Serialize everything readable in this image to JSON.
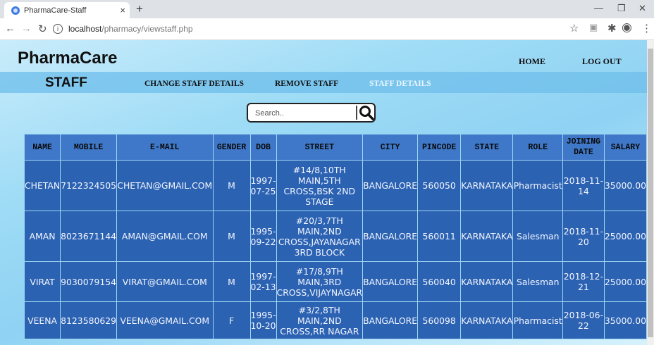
{
  "browser": {
    "tab_title": "PharmaCare-Staff",
    "tab_close": "×",
    "new_tab": "+",
    "url_host": "localhost",
    "url_path": "/pharmacy/viewstaff.php"
  },
  "header": {
    "logo": "PharmaCare",
    "home": "HOME",
    "logout": "LOG OUT"
  },
  "subnav": {
    "title": "STAFF",
    "change": "CHANGE STAFF DETAILS",
    "remove": "REMOVE STAFF",
    "details": "STAFF DETAILS"
  },
  "search": {
    "placeholder": "Search.."
  },
  "table": {
    "headers": [
      "NAME",
      "MOBILE",
      "E-MAIL",
      "GENDER",
      "DOB",
      "STREET",
      "CITY",
      "PINCODE",
      "STATE",
      "ROLE",
      "JOINING DATE",
      "SALARY"
    ],
    "rows": [
      {
        "name": "CHETAN",
        "mobile": "7122324505",
        "email": "CHETAN@GMAIL.COM",
        "gender": "M",
        "dob": "1997-07-25",
        "street": "#14/8,10TH MAIN,5TH CROSS,BSK 2ND STAGE",
        "city": "BANGALORE",
        "pincode": "560050",
        "state": "KARNATAKA",
        "role": "Pharmacist",
        "joining": "2018-11-14",
        "salary": "35000.00"
      },
      {
        "name": "AMAN",
        "mobile": "8023671144",
        "email": "AMAN@GMAIL.COM",
        "gender": "M",
        "dob": "1995-09-22",
        "street": "#20/3,7TH MAIN,2ND CROSS,JAYANAGAR 3RD BLOCK",
        "city": "BANGALORE",
        "pincode": "560011",
        "state": "KARNATAKA",
        "role": "Salesman",
        "joining": "2018-11-20",
        "salary": "25000.00"
      },
      {
        "name": "VIRAT",
        "mobile": "9030079154",
        "email": "VIRAT@GMAIL.COM",
        "gender": "M",
        "dob": "1997-02-13",
        "street": "#17/8,9TH MAIN,3RD CROSS,VIJAYNAGAR",
        "city": "BANGALORE",
        "pincode": "560040",
        "state": "KARNATAKA",
        "role": "Salesman",
        "joining": "2018-12-21",
        "salary": "25000.00"
      },
      {
        "name": "VEENA",
        "mobile": "8123580629",
        "email": "VEENA@GMAIL.COM",
        "gender": "F",
        "dob": "1995-10-20",
        "street": "#3/2,8TH MAIN,2ND CROSS,RR NAGAR",
        "city": "BANGALORE",
        "pincode": "560098",
        "state": "KARNATAKA",
        "role": "Pharmacist",
        "joining": "2018-06-22",
        "salary": "35000.00"
      }
    ]
  }
}
